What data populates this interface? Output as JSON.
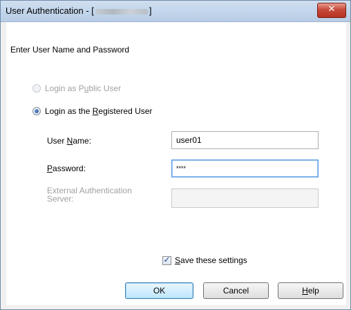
{
  "window": {
    "title_prefix": "User Authentication - [",
    "title_suffix": "]",
    "close_glyph": "✕"
  },
  "dialog": {
    "prompt": "Enter User Name and Password",
    "radio_public": {
      "pre": "Login as P",
      "mnemonic": "u",
      "post": "blic User",
      "selected": false,
      "enabled": false
    },
    "radio_registered": {
      "pre": "Login as the ",
      "mnemonic": "R",
      "post": "egistered User",
      "selected": true,
      "enabled": true
    },
    "username": {
      "label_pre": "User ",
      "label_mnemonic": "N",
      "label_post": "ame:",
      "value": "user01"
    },
    "password": {
      "label_pre": "",
      "label_mnemonic": "P",
      "label_post": "assword:",
      "value": "****"
    },
    "external_server": {
      "label_line1": "External Authentication",
      "label_line2": "Server:",
      "value": ""
    },
    "save_settings": {
      "pre": "",
      "mnemonic": "S",
      "post": "ave these settings",
      "checked": true,
      "check_glyph": "✓"
    }
  },
  "buttons": {
    "ok": "OK",
    "cancel": "Cancel",
    "help_pre": "",
    "help_mnemonic": "H",
    "help_post": "elp"
  }
}
